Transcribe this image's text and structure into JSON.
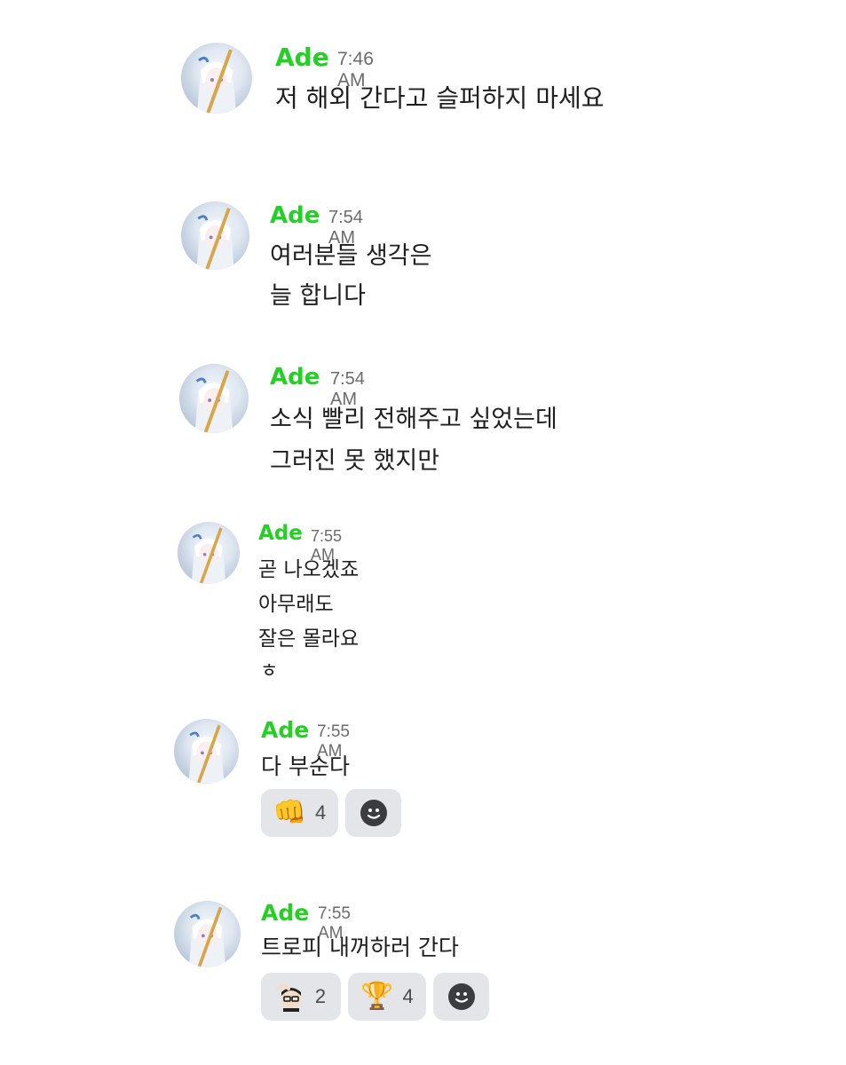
{
  "messages": [
    {
      "author": "Ade",
      "time": "7:46 AM",
      "lines": [
        "저 해외 간다고 슬퍼하지 마세요"
      ]
    },
    {
      "author": "Ade",
      "time": "7:54 AM",
      "lines": [
        "여러분들 생각은",
        "늘 합니다"
      ]
    },
    {
      "author": "Ade",
      "time": "7:54 AM",
      "lines": [
        "소식 빨리 전해주고 싶었는데",
        "그러진 못 했지만"
      ]
    },
    {
      "author": "Ade",
      "time": "7:55 AM",
      "lines": [
        "곧 나오겠죠",
        "아무래도",
        "잘은 몰라요",
        "ㅎ"
      ]
    },
    {
      "author": "Ade",
      "time": "7:55 AM",
      "lines": [
        "다 부순다"
      ],
      "reactions": [
        {
          "emoji": "👊",
          "icon": "fist-icon",
          "count": "4"
        }
      ]
    },
    {
      "author": "Ade",
      "time": "7:55 AM",
      "lines": [
        "트로피 내꺼하러 간다"
      ],
      "reactions": [
        {
          "emoji": "",
          "icon": "custom-avatar-emoji-icon",
          "count": "2"
        },
        {
          "emoji": "🏆",
          "icon": "trophy-icon",
          "count": "4"
        }
      ]
    }
  ],
  "colors": {
    "username": "#23d023",
    "reaction_bg": "#e4e5e9",
    "timestamp": "#6b6b6b"
  }
}
